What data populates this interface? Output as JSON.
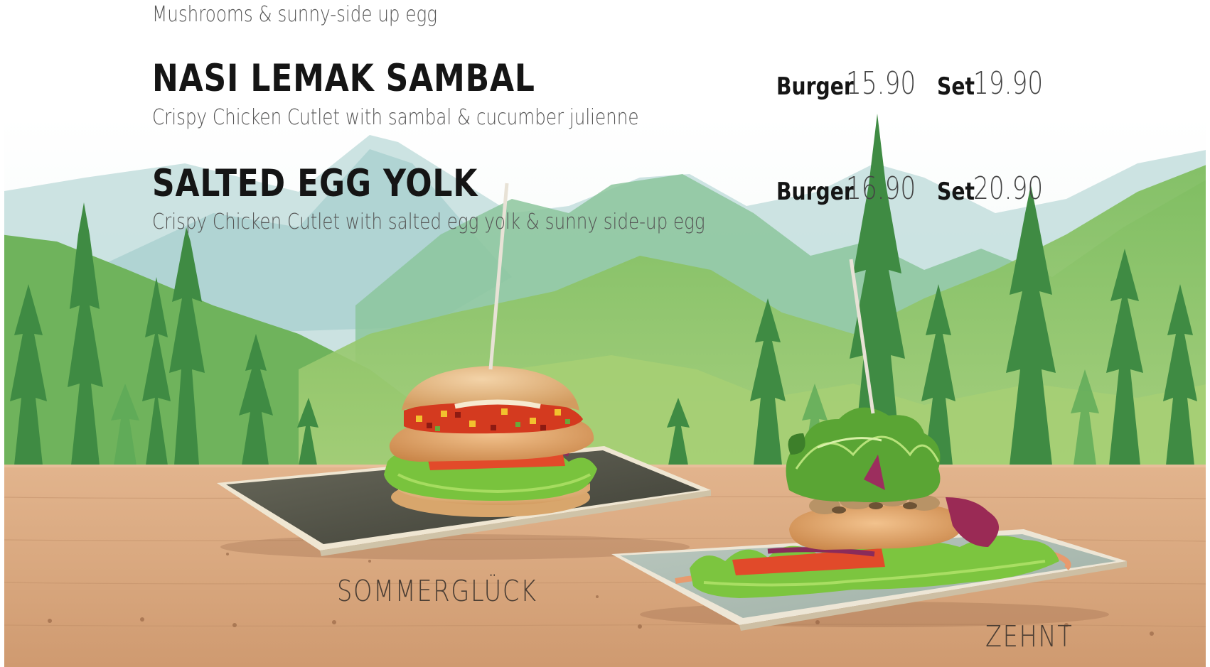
{
  "menu": {
    "partial_top_desc": "Mushrooms & sunny-side up egg",
    "items": [
      {
        "name": "NASI LEMAK SAMBAL",
        "desc": "Crispy Chicken Cutlet with sambal & cucumber julienne",
        "burger_label": "Burger",
        "burger_price": "15.90",
        "set_label": "Set",
        "set_price": "19.90"
      },
      {
        "name": "SALTED EGG YOLK",
        "desc": "Crispy Chicken Cutlet with salted egg yolk & sunny side-up egg",
        "burger_label": "Burger",
        "burger_price": "16.90",
        "set_label": "Set",
        "set_price": "20.90"
      }
    ]
  },
  "captions": {
    "left": "SOMMERGLÜCK",
    "right": "ZEHNT"
  },
  "colors": {
    "sky": "#ffffff",
    "mountain": "#8cc2a6",
    "forest": "#4e9a48",
    "table_wood": "#d9a880",
    "text_dark": "#151515",
    "text_light": "#555555"
  }
}
